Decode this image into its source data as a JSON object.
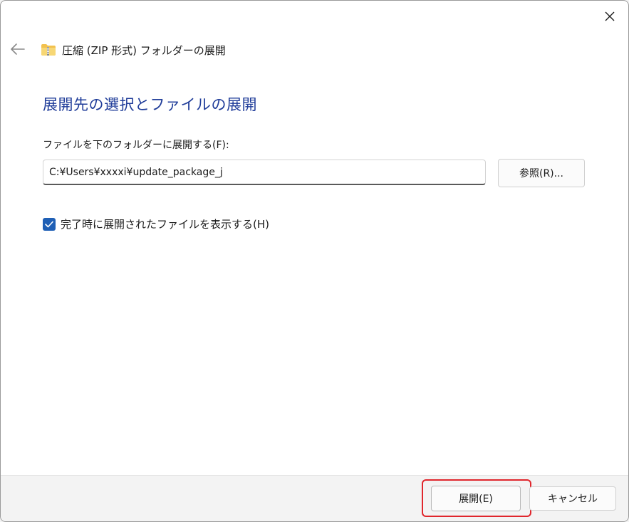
{
  "window": {
    "title": "圧縮 (ZIP 形式) フォルダーの展開"
  },
  "main": {
    "heading": "展開先の選択とファイルの展開",
    "field_label": "ファイルを下のフォルダーに展開する(F):",
    "path_value": "C:¥Users¥xxxxi¥update_package_j",
    "browse_label": "参照(R)...",
    "checkbox_label": "完了時に展開されたファイルを表示する(H)",
    "checkbox_checked": true
  },
  "footer": {
    "extract_label": "展開(E)",
    "cancel_label": "キャンセル"
  },
  "colors": {
    "heading": "#1f3c99",
    "checkbox_accent": "#1f5fb5",
    "highlight": "#e0262c"
  },
  "icons": {
    "close": "close-icon",
    "back": "back-arrow-icon",
    "zip_folder": "zip-folder-icon",
    "check": "checkmark-icon"
  }
}
